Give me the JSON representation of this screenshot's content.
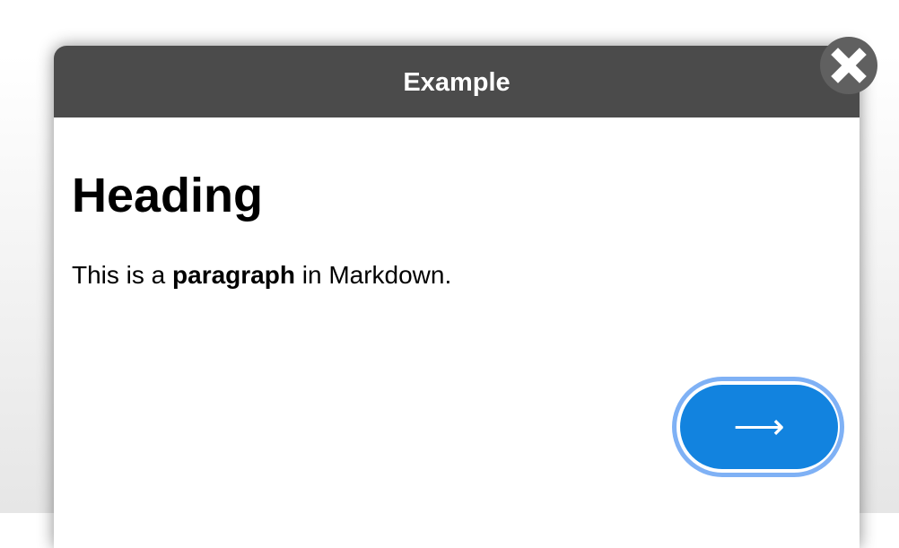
{
  "dialog": {
    "title": "Example",
    "close_icon": "close-x-icon",
    "heading": "Heading",
    "paragraph": {
      "before": "This is a ",
      "bold": "paragraph",
      "after": " in Markdown."
    },
    "next_button": {
      "label": "⟶",
      "icon": "arrow-right-icon"
    }
  },
  "colors": {
    "header": "#4b4b4b",
    "button": "#1283df",
    "button_ring": "#7fb1f5",
    "close_bg": "#606060"
  }
}
